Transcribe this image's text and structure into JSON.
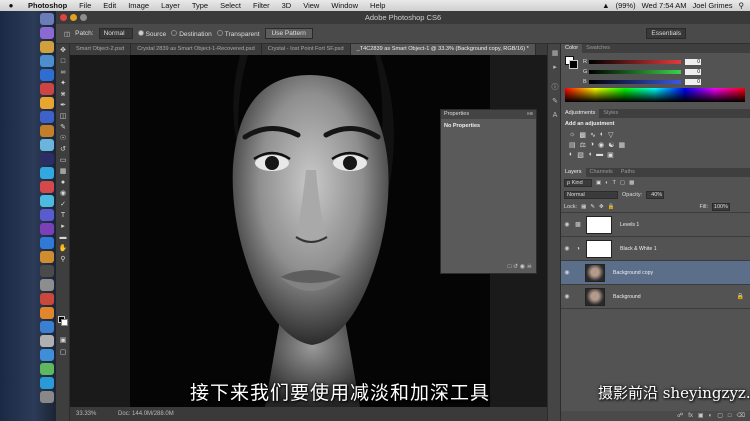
{
  "menubar": {
    "apple": "",
    "app": "Photoshop",
    "items": [
      "File",
      "Edit",
      "Image",
      "Layer",
      "Type",
      "Select",
      "Filter",
      "3D",
      "View",
      "Window",
      "Help"
    ],
    "battery": "(99%)",
    "clock": "Wed 7:54 AM",
    "user": "Joel Grimes"
  },
  "window": {
    "title": "Adobe Photoshop CS6"
  },
  "options": {
    "patch_label": "Patch:",
    "patch_value": "Normal",
    "source_label": "Source",
    "destination_label": "Destination",
    "transparent_label": "Transparent",
    "use_pattern_label": "Use Pattern",
    "workspace": "Essentials"
  },
  "tabs": [
    {
      "label": "Smart Object-2.psd"
    },
    {
      "label": "Crystal 2839 as Smart Object-1-Recovered.psd"
    },
    {
      "label": "Crystal - Iost Point Fort SF.psd"
    },
    {
      "label": "_T4C2839 as Smart Object-1 @ 33.3% (Background copy, RGB/16) *"
    }
  ],
  "properties": {
    "title": "Properties",
    "controls": "»≡",
    "body": "No Properties"
  },
  "statusbar": {
    "zoom": "33.33%",
    "doc": "Doc: 144.0M/288.0M"
  },
  "color_panel": {
    "tabs": [
      "Color",
      "Swatches"
    ],
    "channels": [
      {
        "label": "R",
        "value": "0",
        "color": "#e33b3b"
      },
      {
        "label": "G",
        "value": "0",
        "color": "#3bd14b"
      },
      {
        "label": "B",
        "value": "0",
        "color": "#3b58e3"
      }
    ]
  },
  "adjustments_panel": {
    "tabs": [
      "Adjustments",
      "Styles"
    ],
    "title": "Add an adjustment"
  },
  "layers_panel": {
    "tabs": [
      "Layers",
      "Channels",
      "Paths"
    ],
    "filter": "ρ Kind",
    "blend_mode": "Normal",
    "opacity_label": "Opacity:",
    "opacity_value": "40%",
    "lock_label": "Lock:",
    "fill_label": "Fill:",
    "fill_value": "100%",
    "layers": [
      {
        "name": "Levels 1",
        "type": "adjustment",
        "active": false
      },
      {
        "name": "Black & White 1",
        "type": "adjustment",
        "active": false
      },
      {
        "name": "Background copy",
        "type": "image",
        "active": true
      },
      {
        "name": "Background",
        "type": "image",
        "active": false,
        "locked": true
      }
    ]
  },
  "subtitle": "接下来我们要使用减淡和加深工具",
  "watermark": "摄影前沿 sheyingzyz.com"
}
